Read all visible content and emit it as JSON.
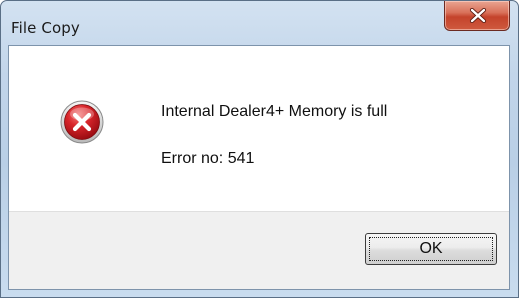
{
  "window": {
    "title": "File Copy",
    "close_icon": "close-x-icon"
  },
  "message": {
    "icon": "error-icon",
    "line1": "Internal Dealer4+ Memory is full",
    "line2": "Error no: 541"
  },
  "buttons": {
    "ok_label": "OK"
  },
  "colors": {
    "close_button": "#c4432b",
    "error_icon": "#c8161d",
    "footer_background": "#f0f0f0"
  }
}
